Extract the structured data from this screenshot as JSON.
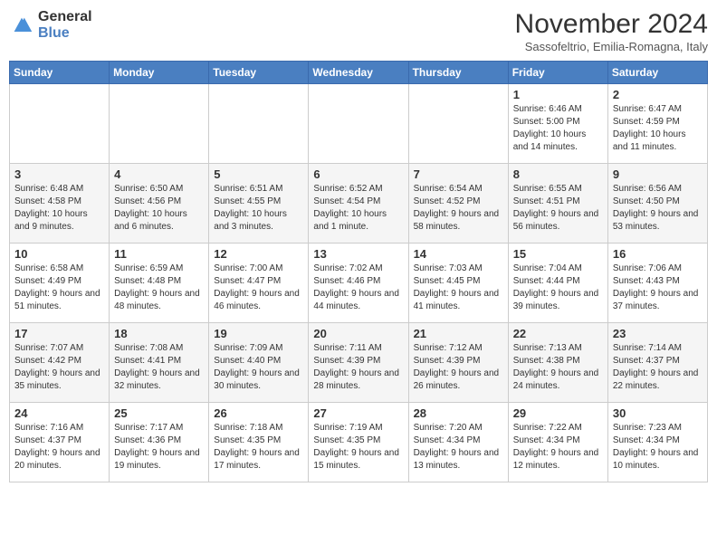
{
  "logo": {
    "line1": "General",
    "line2": "Blue"
  },
  "title": "November 2024",
  "subtitle": "Sassofeltrio, Emilia-Romagna, Italy",
  "weekdays": [
    "Sunday",
    "Monday",
    "Tuesday",
    "Wednesday",
    "Thursday",
    "Friday",
    "Saturday"
  ],
  "weeks": [
    [
      {
        "day": "",
        "info": ""
      },
      {
        "day": "",
        "info": ""
      },
      {
        "day": "",
        "info": ""
      },
      {
        "day": "",
        "info": ""
      },
      {
        "day": "",
        "info": ""
      },
      {
        "day": "1",
        "info": "Sunrise: 6:46 AM\nSunset: 5:00 PM\nDaylight: 10 hours and 14 minutes."
      },
      {
        "day": "2",
        "info": "Sunrise: 6:47 AM\nSunset: 4:59 PM\nDaylight: 10 hours and 11 minutes."
      }
    ],
    [
      {
        "day": "3",
        "info": "Sunrise: 6:48 AM\nSunset: 4:58 PM\nDaylight: 10 hours and 9 minutes."
      },
      {
        "day": "4",
        "info": "Sunrise: 6:50 AM\nSunset: 4:56 PM\nDaylight: 10 hours and 6 minutes."
      },
      {
        "day": "5",
        "info": "Sunrise: 6:51 AM\nSunset: 4:55 PM\nDaylight: 10 hours and 3 minutes."
      },
      {
        "day": "6",
        "info": "Sunrise: 6:52 AM\nSunset: 4:54 PM\nDaylight: 10 hours and 1 minute."
      },
      {
        "day": "7",
        "info": "Sunrise: 6:54 AM\nSunset: 4:52 PM\nDaylight: 9 hours and 58 minutes."
      },
      {
        "day": "8",
        "info": "Sunrise: 6:55 AM\nSunset: 4:51 PM\nDaylight: 9 hours and 56 minutes."
      },
      {
        "day": "9",
        "info": "Sunrise: 6:56 AM\nSunset: 4:50 PM\nDaylight: 9 hours and 53 minutes."
      }
    ],
    [
      {
        "day": "10",
        "info": "Sunrise: 6:58 AM\nSunset: 4:49 PM\nDaylight: 9 hours and 51 minutes."
      },
      {
        "day": "11",
        "info": "Sunrise: 6:59 AM\nSunset: 4:48 PM\nDaylight: 9 hours and 48 minutes."
      },
      {
        "day": "12",
        "info": "Sunrise: 7:00 AM\nSunset: 4:47 PM\nDaylight: 9 hours and 46 minutes."
      },
      {
        "day": "13",
        "info": "Sunrise: 7:02 AM\nSunset: 4:46 PM\nDaylight: 9 hours and 44 minutes."
      },
      {
        "day": "14",
        "info": "Sunrise: 7:03 AM\nSunset: 4:45 PM\nDaylight: 9 hours and 41 minutes."
      },
      {
        "day": "15",
        "info": "Sunrise: 7:04 AM\nSunset: 4:44 PM\nDaylight: 9 hours and 39 minutes."
      },
      {
        "day": "16",
        "info": "Sunrise: 7:06 AM\nSunset: 4:43 PM\nDaylight: 9 hours and 37 minutes."
      }
    ],
    [
      {
        "day": "17",
        "info": "Sunrise: 7:07 AM\nSunset: 4:42 PM\nDaylight: 9 hours and 35 minutes."
      },
      {
        "day": "18",
        "info": "Sunrise: 7:08 AM\nSunset: 4:41 PM\nDaylight: 9 hours and 32 minutes."
      },
      {
        "day": "19",
        "info": "Sunrise: 7:09 AM\nSunset: 4:40 PM\nDaylight: 9 hours and 30 minutes."
      },
      {
        "day": "20",
        "info": "Sunrise: 7:11 AM\nSunset: 4:39 PM\nDaylight: 9 hours and 28 minutes."
      },
      {
        "day": "21",
        "info": "Sunrise: 7:12 AM\nSunset: 4:39 PM\nDaylight: 9 hours and 26 minutes."
      },
      {
        "day": "22",
        "info": "Sunrise: 7:13 AM\nSunset: 4:38 PM\nDaylight: 9 hours and 24 minutes."
      },
      {
        "day": "23",
        "info": "Sunrise: 7:14 AM\nSunset: 4:37 PM\nDaylight: 9 hours and 22 minutes."
      }
    ],
    [
      {
        "day": "24",
        "info": "Sunrise: 7:16 AM\nSunset: 4:37 PM\nDaylight: 9 hours and 20 minutes."
      },
      {
        "day": "25",
        "info": "Sunrise: 7:17 AM\nSunset: 4:36 PM\nDaylight: 9 hours and 19 minutes."
      },
      {
        "day": "26",
        "info": "Sunrise: 7:18 AM\nSunset: 4:35 PM\nDaylight: 9 hours and 17 minutes."
      },
      {
        "day": "27",
        "info": "Sunrise: 7:19 AM\nSunset: 4:35 PM\nDaylight: 9 hours and 15 minutes."
      },
      {
        "day": "28",
        "info": "Sunrise: 7:20 AM\nSunset: 4:34 PM\nDaylight: 9 hours and 13 minutes."
      },
      {
        "day": "29",
        "info": "Sunrise: 7:22 AM\nSunset: 4:34 PM\nDaylight: 9 hours and 12 minutes."
      },
      {
        "day": "30",
        "info": "Sunrise: 7:23 AM\nSunset: 4:34 PM\nDaylight: 9 hours and 10 minutes."
      }
    ]
  ]
}
